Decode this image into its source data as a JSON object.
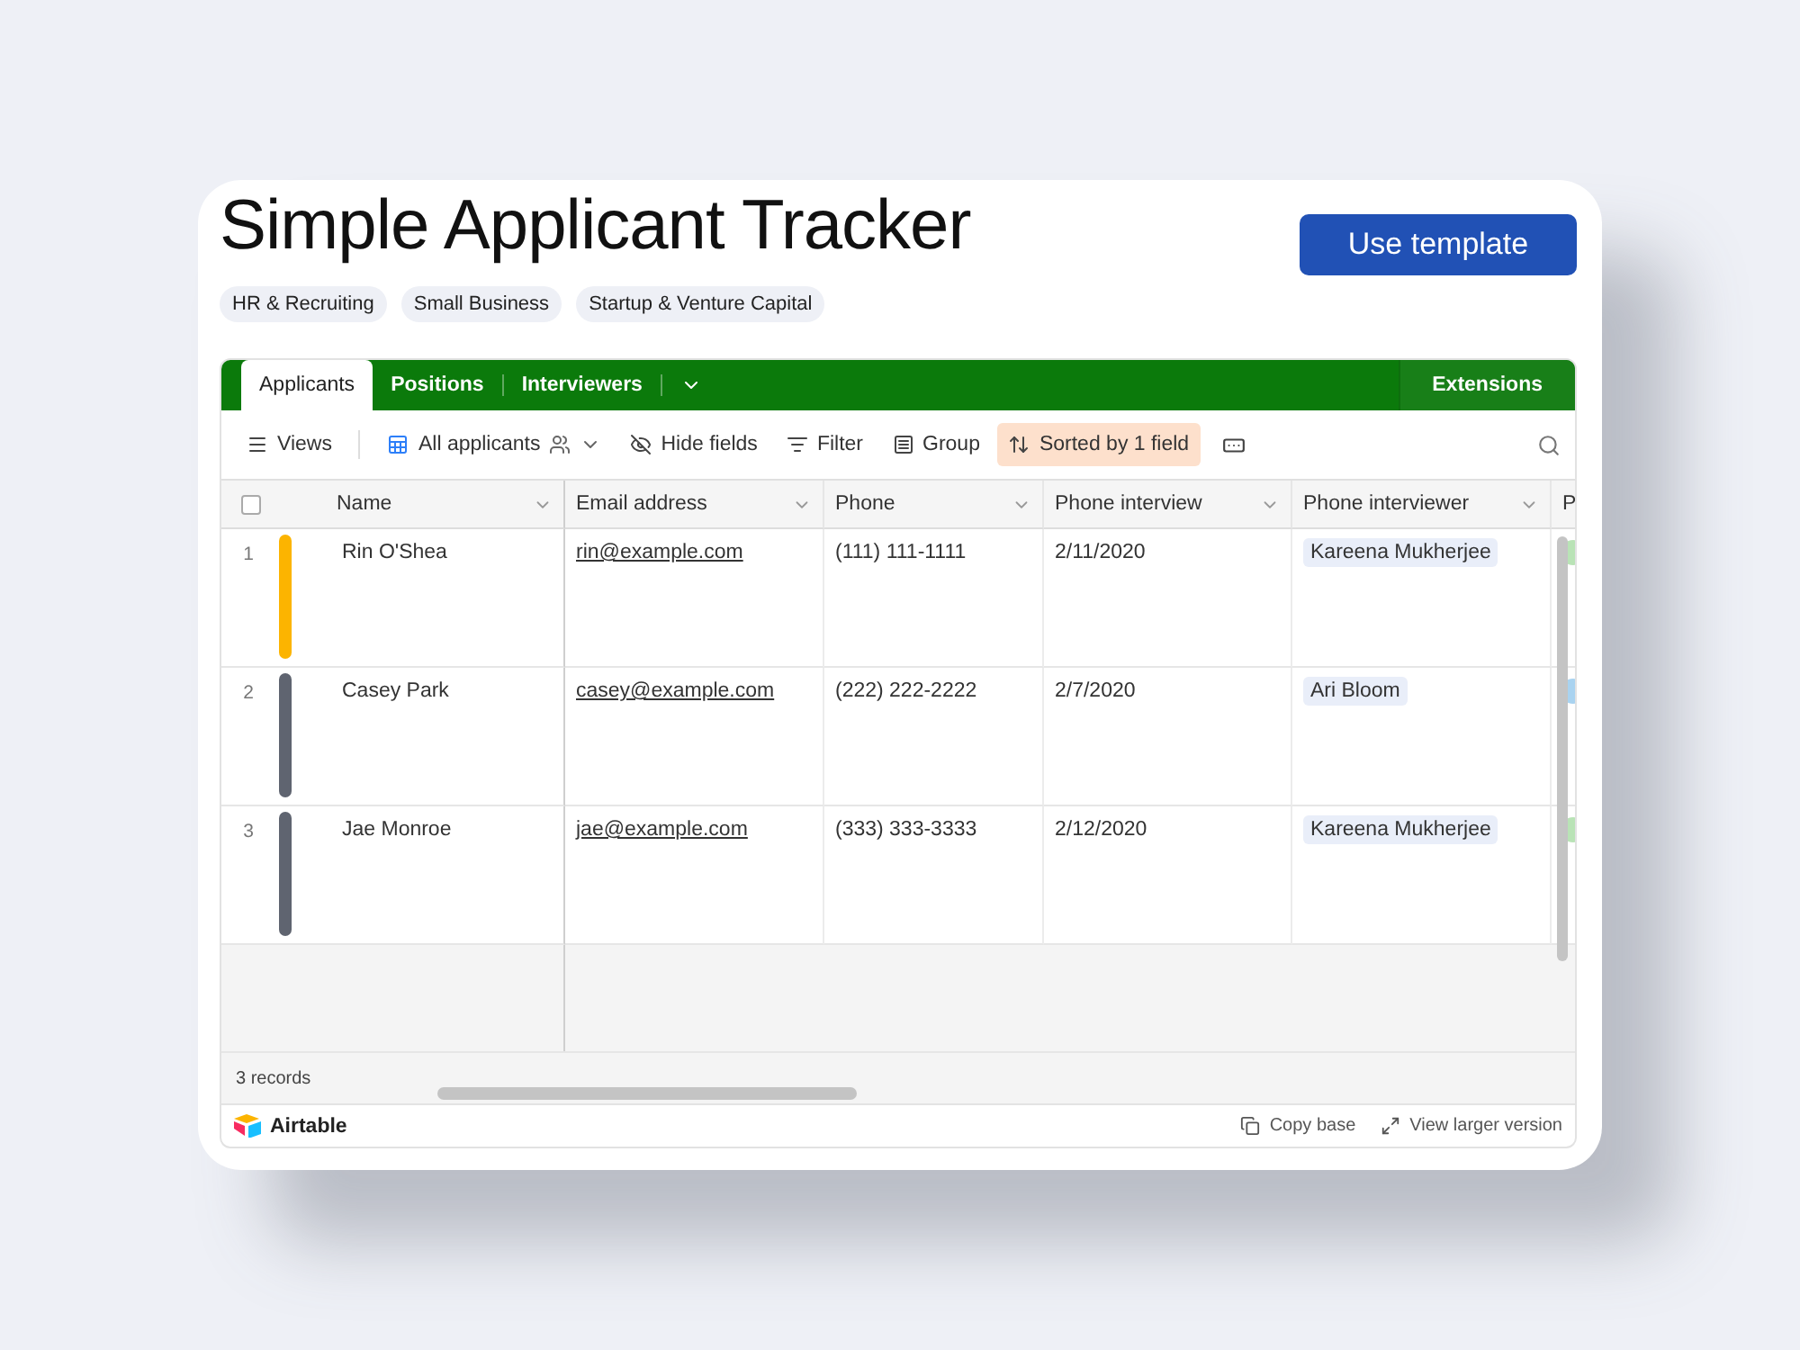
{
  "title": "Simple Applicant Tracker",
  "action_button": "Use template",
  "tags": [
    "HR & Recruiting",
    "Small Business",
    "Startup & Venture Capital"
  ],
  "tabs": [
    {
      "label": "Applicants",
      "selected": true
    },
    {
      "label": "Positions",
      "selected": false
    },
    {
      "label": "Interviewers",
      "selected": false
    }
  ],
  "extensions": "Extensions",
  "toolbar": [
    {
      "label": "Views",
      "highlighted": false
    },
    {
      "label": "All applicants",
      "highlighted": false
    },
    {
      "label": "Hide fields",
      "highlighted": false
    },
    {
      "label": "Filter",
      "highlighted": false
    },
    {
      "label": "Group",
      "highlighted": false
    },
    {
      "label": "Sorted by 1 field",
      "highlighted": true
    }
  ],
  "table": {
    "columns": [
      "Name",
      "Email address",
      "Phone",
      "Phone interview",
      "Phone interviewer",
      "P"
    ],
    "rows": [
      {
        "number": "1",
        "color": "#fcb400",
        "name": "Rin O'Shea",
        "email": "rin@example.com",
        "phone": "(111) 111-1111",
        "interview": "2/11/2020",
        "interviewer": "Kareena Mukherjee",
        "column_6": {
          "color": "#b9e3b6"
        }
      },
      {
        "number": "2",
        "color": "#5f6470",
        "name": "Casey Park",
        "email": "casey@example.com",
        "phone": "(222) 222-2222",
        "interview": "2/7/2020",
        "interviewer": "Ari Bloom",
        "column_6": {
          "color": "#a9d3f0"
        }
      },
      {
        "number": "3",
        "color": "#5f6470",
        "name": "Jae Monroe",
        "email": "jae@example.com",
        "phone": "(333) 333-3333",
        "interview": "2/12/2020",
        "interviewer": "Kareena Mukherjee",
        "column_6": {
          "color": "#b9e3b6"
        }
      }
    ],
    "select_all_checked": false
  },
  "record_count": "3 records",
  "footer": {
    "brand": "Airtable",
    "links": [
      "Copy base",
      "View larger version"
    ]
  }
}
